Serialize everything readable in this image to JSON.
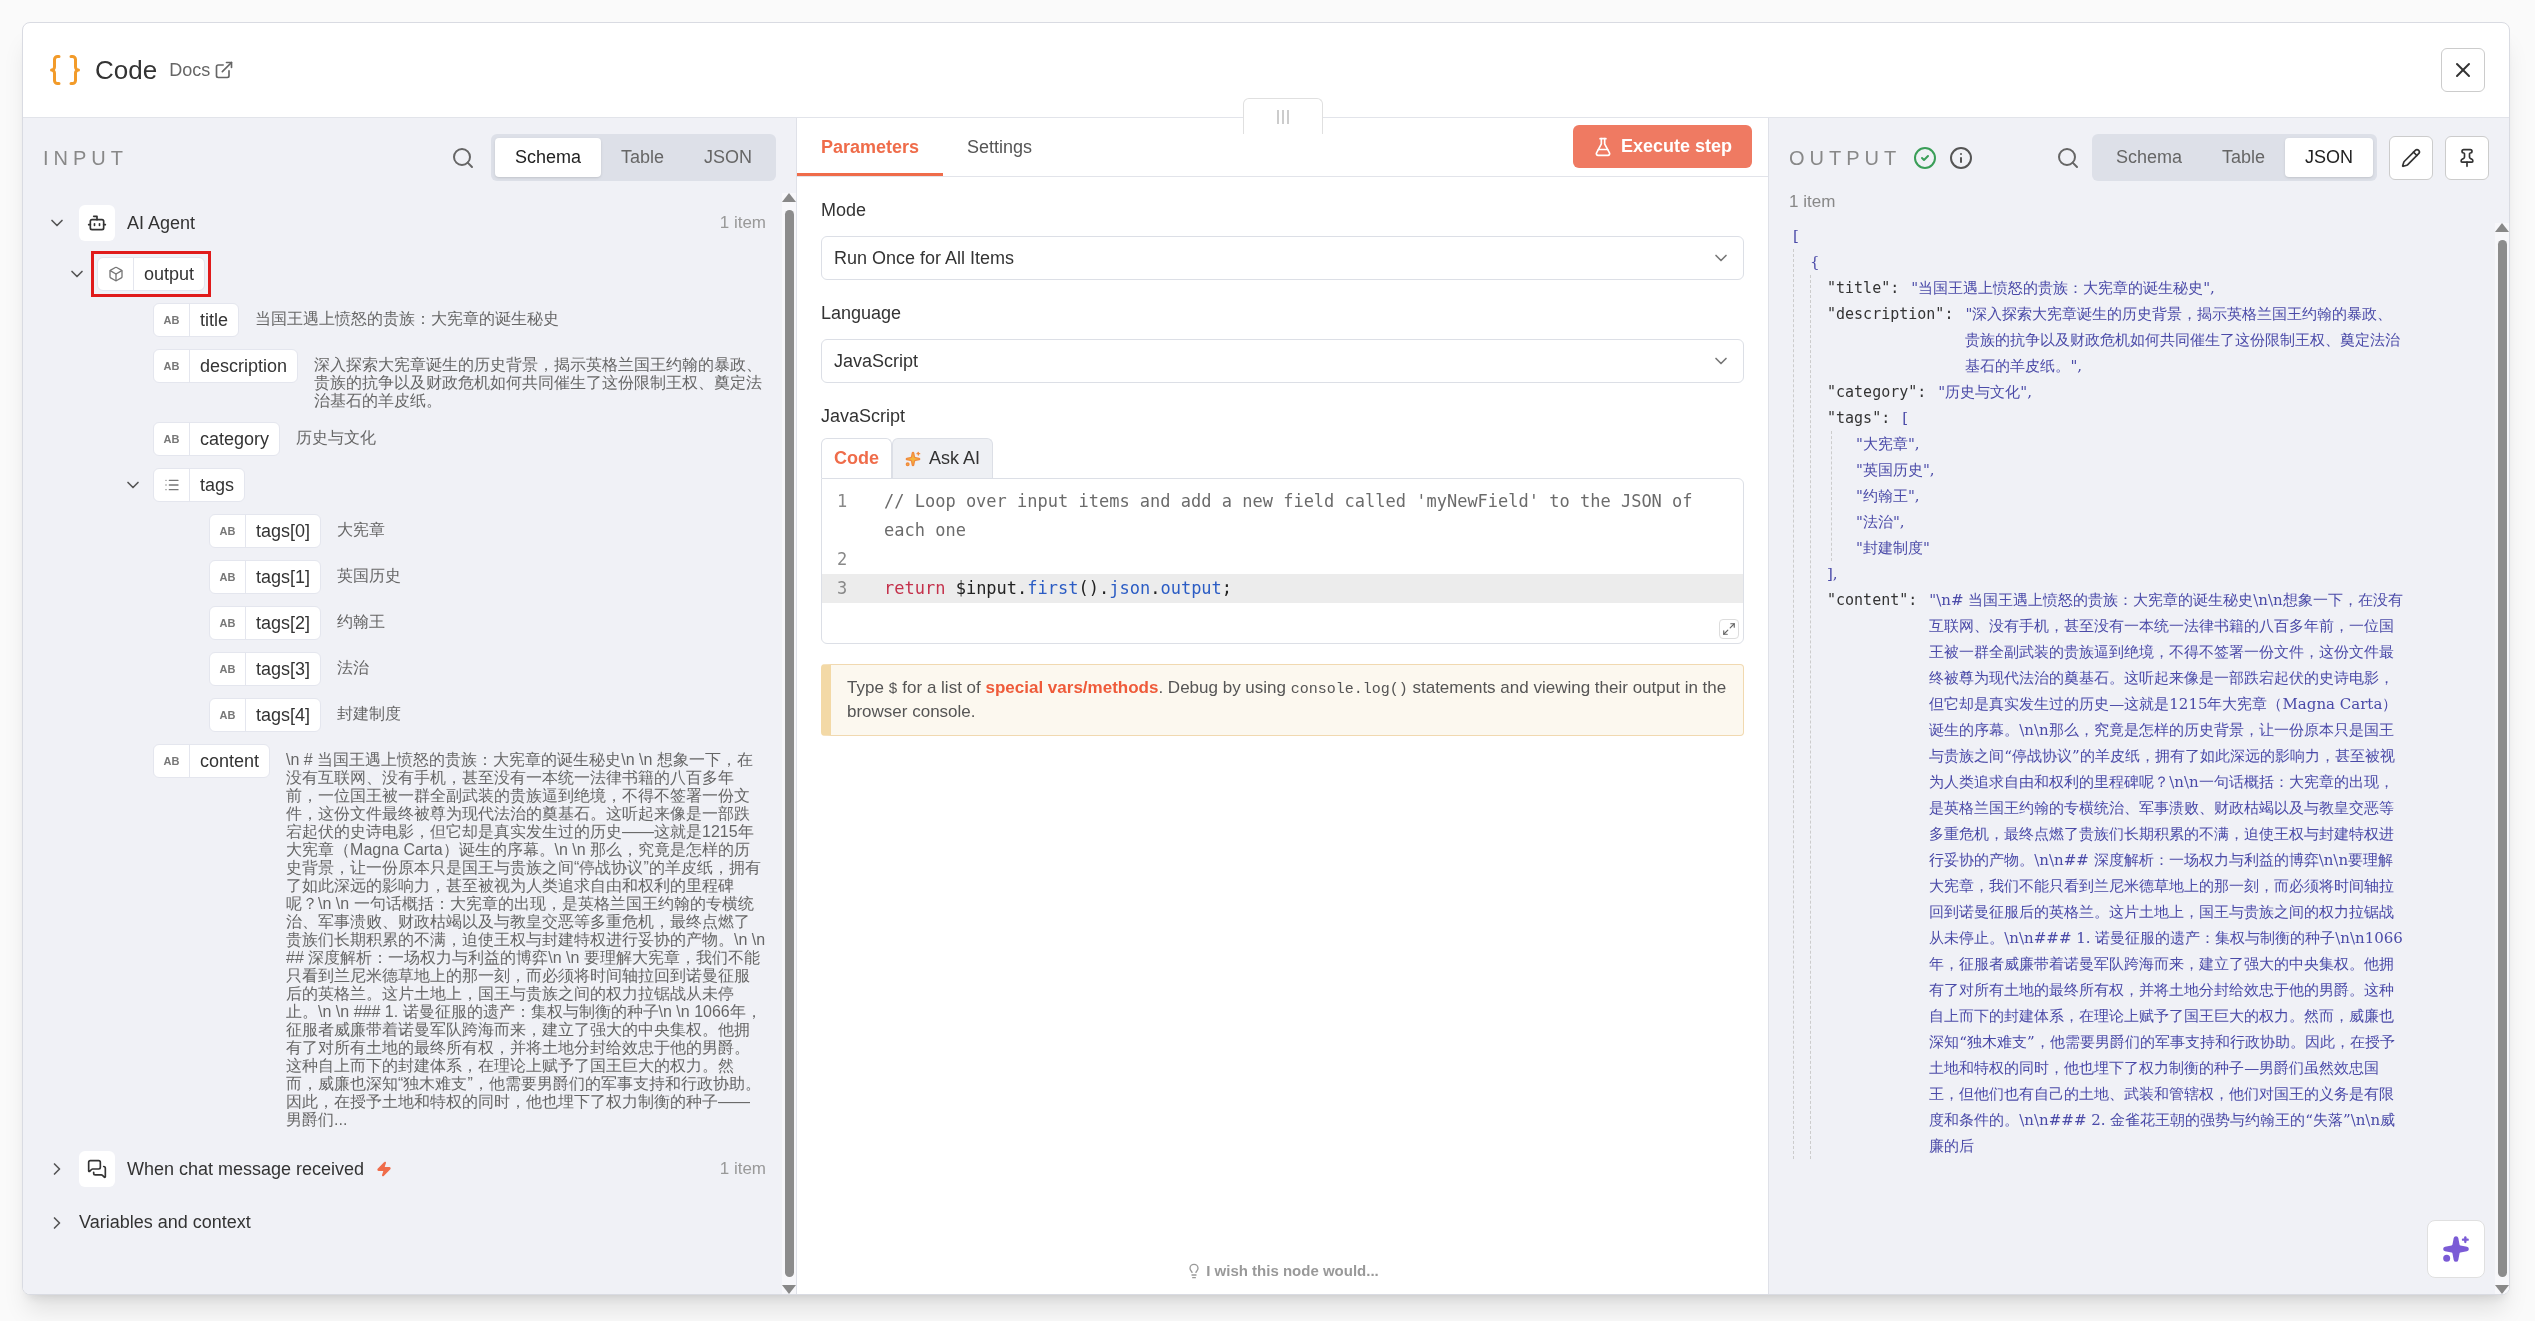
{
  "dialog": {
    "title": "Code",
    "docs_link": "Docs"
  },
  "input": {
    "heading": "INPUT",
    "views": [
      {
        "label": "Schema",
        "selected": true
      },
      {
        "label": "Table",
        "selected": false
      },
      {
        "label": "JSON",
        "selected": false
      }
    ],
    "tree": [
      {
        "kind": "agent",
        "name": "AI Agent",
        "count": "1 item",
        "expanded": true,
        "children": [
          {
            "kind": "object",
            "name": "output",
            "expanded": true,
            "highlighted": true,
            "children": [
              {
                "kind": "string",
                "type_label": "AB",
                "name": "title",
                "value": "当国王遇上愤怒的贵族：大宪章的诞生秘史"
              },
              {
                "kind": "string",
                "type_label": "AB",
                "name": "description",
                "value": "深入探索大宪章诞生的历史背景，揭示英格兰国王约翰的暴政、贵族的抗争以及财政危机如何共同催生了这份限制王权、奠定法治基石的羊皮纸。"
              },
              {
                "kind": "string",
                "type_label": "AB",
                "name": "category",
                "value": "历史与文化"
              },
              {
                "kind": "array",
                "name": "tags",
                "expanded": true,
                "children": [
                  {
                    "kind": "string",
                    "type_label": "AB",
                    "name": "tags[0]",
                    "value": "大宪章"
                  },
                  {
                    "kind": "string",
                    "type_label": "AB",
                    "name": "tags[1]",
                    "value": "英国历史"
                  },
                  {
                    "kind": "string",
                    "type_label": "AB",
                    "name": "tags[2]",
                    "value": "约翰王"
                  },
                  {
                    "kind": "string",
                    "type_label": "AB",
                    "name": "tags[3]",
                    "value": "法治"
                  },
                  {
                    "kind": "string",
                    "type_label": "AB",
                    "name": "tags[4]",
                    "value": "封建制度"
                  }
                ]
              },
              {
                "kind": "string",
                "type_label": "AB",
                "name": "content",
                "value": "\\n # 当国王遇上愤怒的贵族：大宪章的诞生秘史\\n \\n 想象一下，在没有互联网、没有手机，甚至没有一本统一法律书籍的八百多年前，一位国王被一群全副武装的贵族逼到绝境，不得不签署一份文件，这份文件最终被尊为现代法治的奠基石。这听起来像是一部跌宕起伏的史诗电影，但它却是真实发生过的历史——这就是1215年大宪章（Magna Carta）诞生的序幕。\\n \\n 那么，究竟是怎样的历史背景，让一份原本只是国王与贵族之间“停战协议”的羊皮纸，拥有了如此深远的影响力，甚至被视为人类追求自由和权利的里程碑呢？\\n \\n 一句话概括：大宪章的出现，是英格兰国王约翰的专横统治、军事溃败、财政枯竭以及与教皇交恶等多重危机，最终点燃了贵族们长期积累的不满，迫使王权与封建特权进行妥协的产物。\\n \\n ## 深度解析：一场权力与利益的博弈\\n \\n 要理解大宪章，我们不能只看到兰尼米德草地上的那一刻，而必须将时间轴拉回到诺曼征服后的英格兰。这片土地上，国王与贵族之间的权力拉锯战从未停止。\\n \\n ### 1. 诺曼征服的遗产：集权与制衡的种子\\n \\n 1066年，征服者威廉带着诺曼军队跨海而来，建立了强大的中央集权。他拥有了对所有土地的最终所有权，并将土地分封给效忠于他的男爵。这种自上而下的封建体系，在理论上赋予了国王巨大的权力。然而，威廉也深知“独木难支”，他需要男爵们的军事支持和行政协助。因此，在授予土地和特权的同时，他也埋下了权力制衡的种子——男爵们..."
              }
            ]
          }
        ]
      },
      {
        "kind": "chat_trigger",
        "name": "When chat message received",
        "trigger": true,
        "count": "1 item",
        "expanded": false
      }
    ],
    "footer": {
      "label": "Variables and context",
      "expanded": false
    }
  },
  "parameters": {
    "tabs": [
      {
        "label": "Parameters",
        "selected": true
      },
      {
        "label": "Settings",
        "selected": false
      }
    ],
    "execute_button": "Execute step",
    "fields": [
      {
        "label": "Mode",
        "value": "Run Once for All Items"
      },
      {
        "label": "Language",
        "value": "JavaScript"
      }
    ],
    "editor_label": "JavaScript",
    "editor_tabs": [
      {
        "label": "Code",
        "selected": true
      },
      {
        "label": "Ask AI",
        "selected": false
      }
    ],
    "code_lines": [
      {
        "number": "1",
        "active": false,
        "tokens": [
          {
            "kind": "comment",
            "text": "// Loop over input items and add a new field called 'myNewField' to the JSON of each one"
          }
        ]
      },
      {
        "number": "2",
        "active": false
      },
      {
        "number": "3",
        "active": true,
        "tokens": [
          {
            "kind": "keyword",
            "text": "return"
          },
          {
            "kind": "plain",
            "text": " $input."
          },
          {
            "kind": "member",
            "text": "first"
          },
          {
            "kind": "plain",
            "text": "()."
          },
          {
            "kind": "member",
            "text": "json"
          },
          {
            "kind": "plain",
            "text": "."
          },
          {
            "kind": "member",
            "text": "output"
          },
          {
            "kind": "plain",
            "text": ";"
          }
        ]
      }
    ],
    "hint": [
      {
        "kind": "text",
        "text": "Type "
      },
      {
        "kind": "code",
        "text": "$"
      },
      {
        "kind": "text",
        "text": " for a list of "
      },
      {
        "kind": "link",
        "text": "special vars/methods"
      },
      {
        "kind": "text",
        "text": ". Debug by using "
      },
      {
        "kind": "code",
        "text": "console.log()"
      },
      {
        "kind": "text",
        "text": " statements and viewing their output in the browser console."
      }
    ],
    "feedback": "I wish this node would..."
  },
  "output": {
    "heading": "OUTPUT",
    "success": true,
    "views": [
      {
        "label": "Schema",
        "selected": false
      },
      {
        "label": "Table",
        "selected": false
      },
      {
        "label": "JSON",
        "selected": true
      }
    ],
    "count": "1 item",
    "json": {
      "open": "[",
      "object_open": "{",
      "fields": [
        {
          "key": "\"title\":",
          "value": "\"当国王遇上愤怒的贵族：大宪章的诞生秘史\","
        },
        {
          "key": "\"description\":",
          "value": "\"深入探索大宪章诞生的历史背景，揭示英格兰国王约翰的暴政、贵族的抗争以及财政危机如何共同催生了这份限制王权、奠定法治基石的羊皮纸。\","
        },
        {
          "key": "\"category\":",
          "value": "\"历史与文化\","
        },
        {
          "key": "\"tags\":",
          "open": "[",
          "items": [
            "\"大宪章\",",
            "\"英国历史\",",
            "\"约翰王\",",
            "\"法治\",",
            "\"封建制度\""
          ],
          "close": "],"
        },
        {
          "key": "\"content\":",
          "value": "\"\\n# 当国王遇上愤怒的贵族：大宪章的诞生秘史\\n\\n想象一下，在没有互联网、没有手机，甚至没有一本统一法律书籍的八百多年前，一位国王被一群全副武装的贵族逼到绝境，不得不签署一份文件，这份文件最终被尊为现代法治的奠基石。这听起来像是一部跌宕起伏的史诗电影，但它却是真实发生过的历史—这就是1215年大宪章（Magna Carta）诞生的序幕。\\n\\n那么，究竟是怎样的历史背景，让一份原本只是国王与贵族之间“停战协议”的羊皮纸，拥有了如此深远的影响力，甚至被视为人类追求自由和权利的里程碑呢？\\n\\n一句话概括：大宪章的出现，是英格兰国王约翰的专横统治、军事溃败、财政枯竭以及与教皇交恶等多重危机，最终点燃了贵族们长期积累的不满，迫使王权与封建特权进行妥协的产物。\\n\\n## 深度解析：一场权力与利益的博弈\\n\\n要理解大宪章，我们不能只看到兰尼米德草地上的那一刻，而必须将时间轴拉回到诺曼征服后的英格兰。这片土地上，国王与贵族之间的权力拉锯战从未停止。\\n\\n### 1. 诺曼征服的遗产：集权与制衡的种子\\n\\n1066年，征服者威廉带着诺曼军队跨海而来，建立了强大的中央集权。他拥有了对所有土地的最终所有权，并将土地分封给效忠于他的男爵。这种自上而下的封建体系，在理论上赋予了国王巨大的权力。然而，威廉也深知“独木难支”，他需要男爵们的军事支持和行政协助。因此，在授予土地和特权的同时，他也埋下了权力制衡的种子—男爵们虽然效忠国王，但他们也有自己的土地、武装和管辖权，他们对国王的义务是有限度和条件的。\\n\\n### 2. 金雀花王朝的强势与约翰王的“失落”\\n\\n威廉的后"
        }
      ]
    }
  }
}
